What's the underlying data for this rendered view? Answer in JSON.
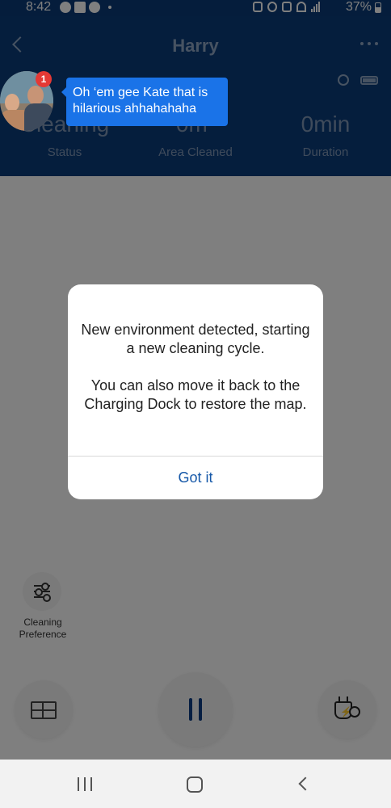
{
  "status_bar": {
    "time": "8:42",
    "battery_percent": "37%"
  },
  "header": {
    "title": "Harry",
    "stats": [
      {
        "value": "Cleaning",
        "label": "Status"
      },
      {
        "value": "0m²",
        "label": "Area Cleaned"
      },
      {
        "value": "0min",
        "label": "Duration"
      }
    ]
  },
  "chat_head": {
    "badge_count": "1",
    "message": "Oh ‘em gee Kate that is hilarious ahhahahaha"
  },
  "dialog": {
    "message_line1": "New environment detected, starting a new cleaning cycle.",
    "message_line2": "You can also move it back to the Charging Dock to restore the map.",
    "button_label": "Got it"
  },
  "controls": {
    "cleaning_preference_label": "Cleaning Preference"
  },
  "icons": {
    "back": "back-arrow-icon",
    "more": "more-dots-icon",
    "pref": "sliders-icon",
    "map": "brick-wall-icon",
    "pause": "pause-icon",
    "dock": "charging-dock-icon"
  },
  "colors": {
    "header_bg": "#0b3c7b",
    "dialog_button": "#1658a8",
    "chat_bubble": "#1a73e8",
    "badge": "#e53935"
  }
}
